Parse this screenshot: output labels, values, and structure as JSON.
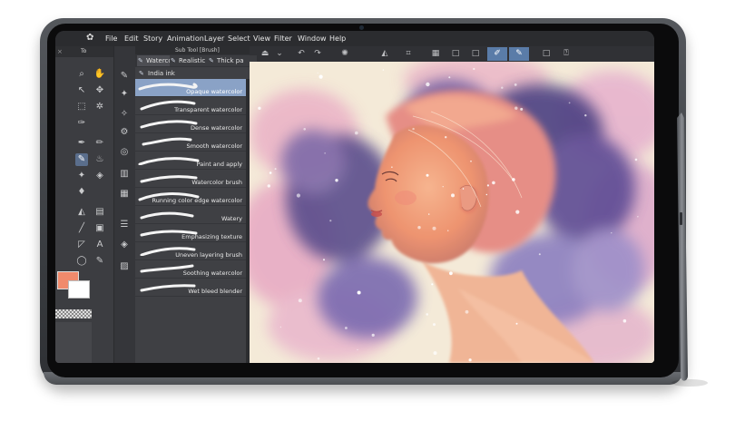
{
  "menubar": {
    "items": [
      "File",
      "Edit",
      "Story",
      "Animation",
      "Layer",
      "Select",
      "View",
      "Filter",
      "Window",
      "Help"
    ]
  },
  "tool_tabs": {
    "tab": "To"
  },
  "brush_panel": {
    "header": "Sub Tool [Brush]",
    "tabs": [
      "Waterco",
      "Realistic",
      "Thick pa"
    ],
    "subgroup": "India ink",
    "selected_index": 0,
    "brushes": [
      "Opaque watercolor",
      "Transparent watercolor",
      "Dense watercolor",
      "Smooth watercolor",
      "Paint and apply",
      "Watercolor brush",
      "Running color edge watercolor",
      "Watery",
      "Emphasizing texture",
      "Uneven layering brush",
      "Soothing watercolor",
      "Wet bleed blender"
    ]
  },
  "colors": {
    "main_color": "#f08a6c",
    "sub_color": "#ffffff",
    "accent": "#5a7ca8"
  },
  "icons": {
    "toolbar": [
      "pen-mode-icon",
      "chevron-down-icon",
      "undo-icon",
      "redo-icon",
      "loading-icon",
      "fill-icon",
      "crop-icon",
      "grid-icon",
      "square-icon",
      "square-icon",
      "active-pen-icon",
      "active-brush-icon",
      "square-icon",
      "help-icon"
    ]
  }
}
